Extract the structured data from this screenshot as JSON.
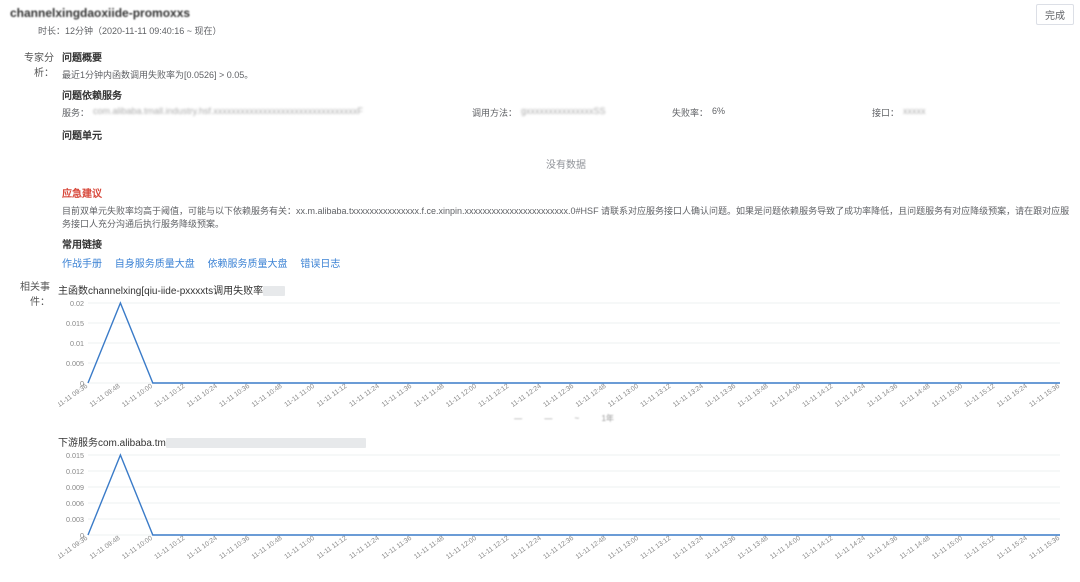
{
  "header": {
    "title_prefix": "channel",
    "title_blur": "xingdaoxiide-promoxxs",
    "complete_label": "完成"
  },
  "duration": "时长：12分钟（2020-11-11 09:40:16 ~ 现在）",
  "expert": {
    "label": "专家分析：",
    "overview_heading": "问题概要",
    "overview_text": "最近1分钟内函数调用失败率为[0.0526] > 0.05。",
    "dep_heading": "问题依赖服务",
    "dep_service_k": "服务",
    "dep_service_v": "com.alibaba.tmall.industry.hsf.xxxxxxxxxxxxxxxxxxxxxxxxxxxxxxxxF",
    "dep_method_k": "调用方法",
    "dep_method_v": "gxxxxxxxxxxxxxxxSS",
    "dep_fail_k": "失败率",
    "dep_fail_v": "6%",
    "dep_iface_k": "接口",
    "dep_iface_v": "xxxxx",
    "unit_heading": "问题单元",
    "nodata": "没有数据",
    "emergency_heading": "应急建议",
    "emergency_body": "目前双单元失败率均高于阈值，可能与以下依赖服务有关：xx.m.alibaba.txxxxxxxxxxxxxxx.f.ce.xinpin.xxxxxxxxxxxxxxxxxxxxxxx.0#HSF 请联系对应服务接口人确认问题。如果是问题依赖服务导致了成功率降低，且问题服务有对应降级预案，请在跟对应服务接口人充分沟通后执行服务降级预案。",
    "links_heading": "常用链接",
    "links": [
      "作战手册",
      "自身服务质量大盘",
      "依赖服务质量大盘",
      "错误日志"
    ]
  },
  "related": {
    "label": "相关事件：",
    "chart1_title": "主函数channelxing[qiu-iide-pxxxxts调用失败率",
    "chart2_title": "下游服务com.alibaba.tm",
    "legend_items": [
      "—",
      "—",
      "~",
      "1年"
    ]
  },
  "chart_data": {
    "type": "line",
    "charts": [
      {
        "name": "chart1",
        "title": "主函数channelxing[qiu-iide-pxxxxts调用失败率",
        "xlabel": "",
        "ylabel": "",
        "ylim": [
          0,
          0.02
        ],
        "yticks": [
          0,
          0.005,
          0.01,
          0.015,
          0.02
        ],
        "categories": [
          "11-11 09:36",
          "11-11 09:48",
          "11-11 10:00",
          "11-11 10:12",
          "11-11 10:24",
          "11-11 10:36",
          "11-11 10:48",
          "11-11 11:00",
          "11-11 11:12",
          "11-11 11:24",
          "11-11 11:36",
          "11-11 11:48",
          "11-11 12:00",
          "11-11 12:12",
          "11-11 12:24",
          "11-11 12:36",
          "11-11 12:48",
          "11-11 13:00",
          "11-11 13:12",
          "11-11 13:24",
          "11-11 13:36",
          "11-11 13:48",
          "11-11 14:00",
          "11-11 14:12",
          "11-11 14:24",
          "11-11 14:36",
          "11-11 14:48",
          "11-11 15:00",
          "11-11 15:12",
          "11-11 15:24",
          "11-11 15:36"
        ],
        "values": [
          0,
          0.02,
          0,
          0,
          0,
          0,
          0,
          0,
          0,
          0,
          0,
          0,
          0,
          0,
          0,
          0,
          0,
          0,
          0,
          0,
          0,
          0,
          0,
          0,
          0,
          0,
          0,
          0,
          0,
          0,
          0
        ]
      },
      {
        "name": "chart2",
        "title": "下游服务com.alibaba.tm…",
        "xlabel": "",
        "ylabel": "",
        "ylim": [
          0,
          0.015
        ],
        "yticks": [
          0,
          0.003,
          0.006,
          0.009,
          0.012,
          0.015
        ],
        "categories": [
          "11-11 09:36",
          "11-11 09:48",
          "11-11 10:00",
          "11-11 10:12",
          "11-11 10:24",
          "11-11 10:36",
          "11-11 10:48",
          "11-11 11:00",
          "11-11 11:12",
          "11-11 11:24",
          "11-11 11:36",
          "11-11 11:48",
          "11-11 12:00",
          "11-11 12:12",
          "11-11 12:24",
          "11-11 12:36",
          "11-11 12:48",
          "11-11 13:00",
          "11-11 13:12",
          "11-11 13:24",
          "11-11 13:36",
          "11-11 13:48",
          "11-11 14:00",
          "11-11 14:12",
          "11-11 14:24",
          "11-11 14:36",
          "11-11 14:48",
          "11-11 15:00",
          "11-11 15:12",
          "11-11 15:24",
          "11-11 15:36"
        ],
        "values": [
          0,
          0.015,
          0,
          0,
          0,
          0,
          0,
          0,
          0,
          0,
          0,
          0,
          0,
          0,
          0,
          0,
          0,
          0,
          0,
          0,
          0,
          0,
          0,
          0,
          0,
          0,
          0,
          0,
          0,
          0,
          0
        ]
      }
    ]
  }
}
